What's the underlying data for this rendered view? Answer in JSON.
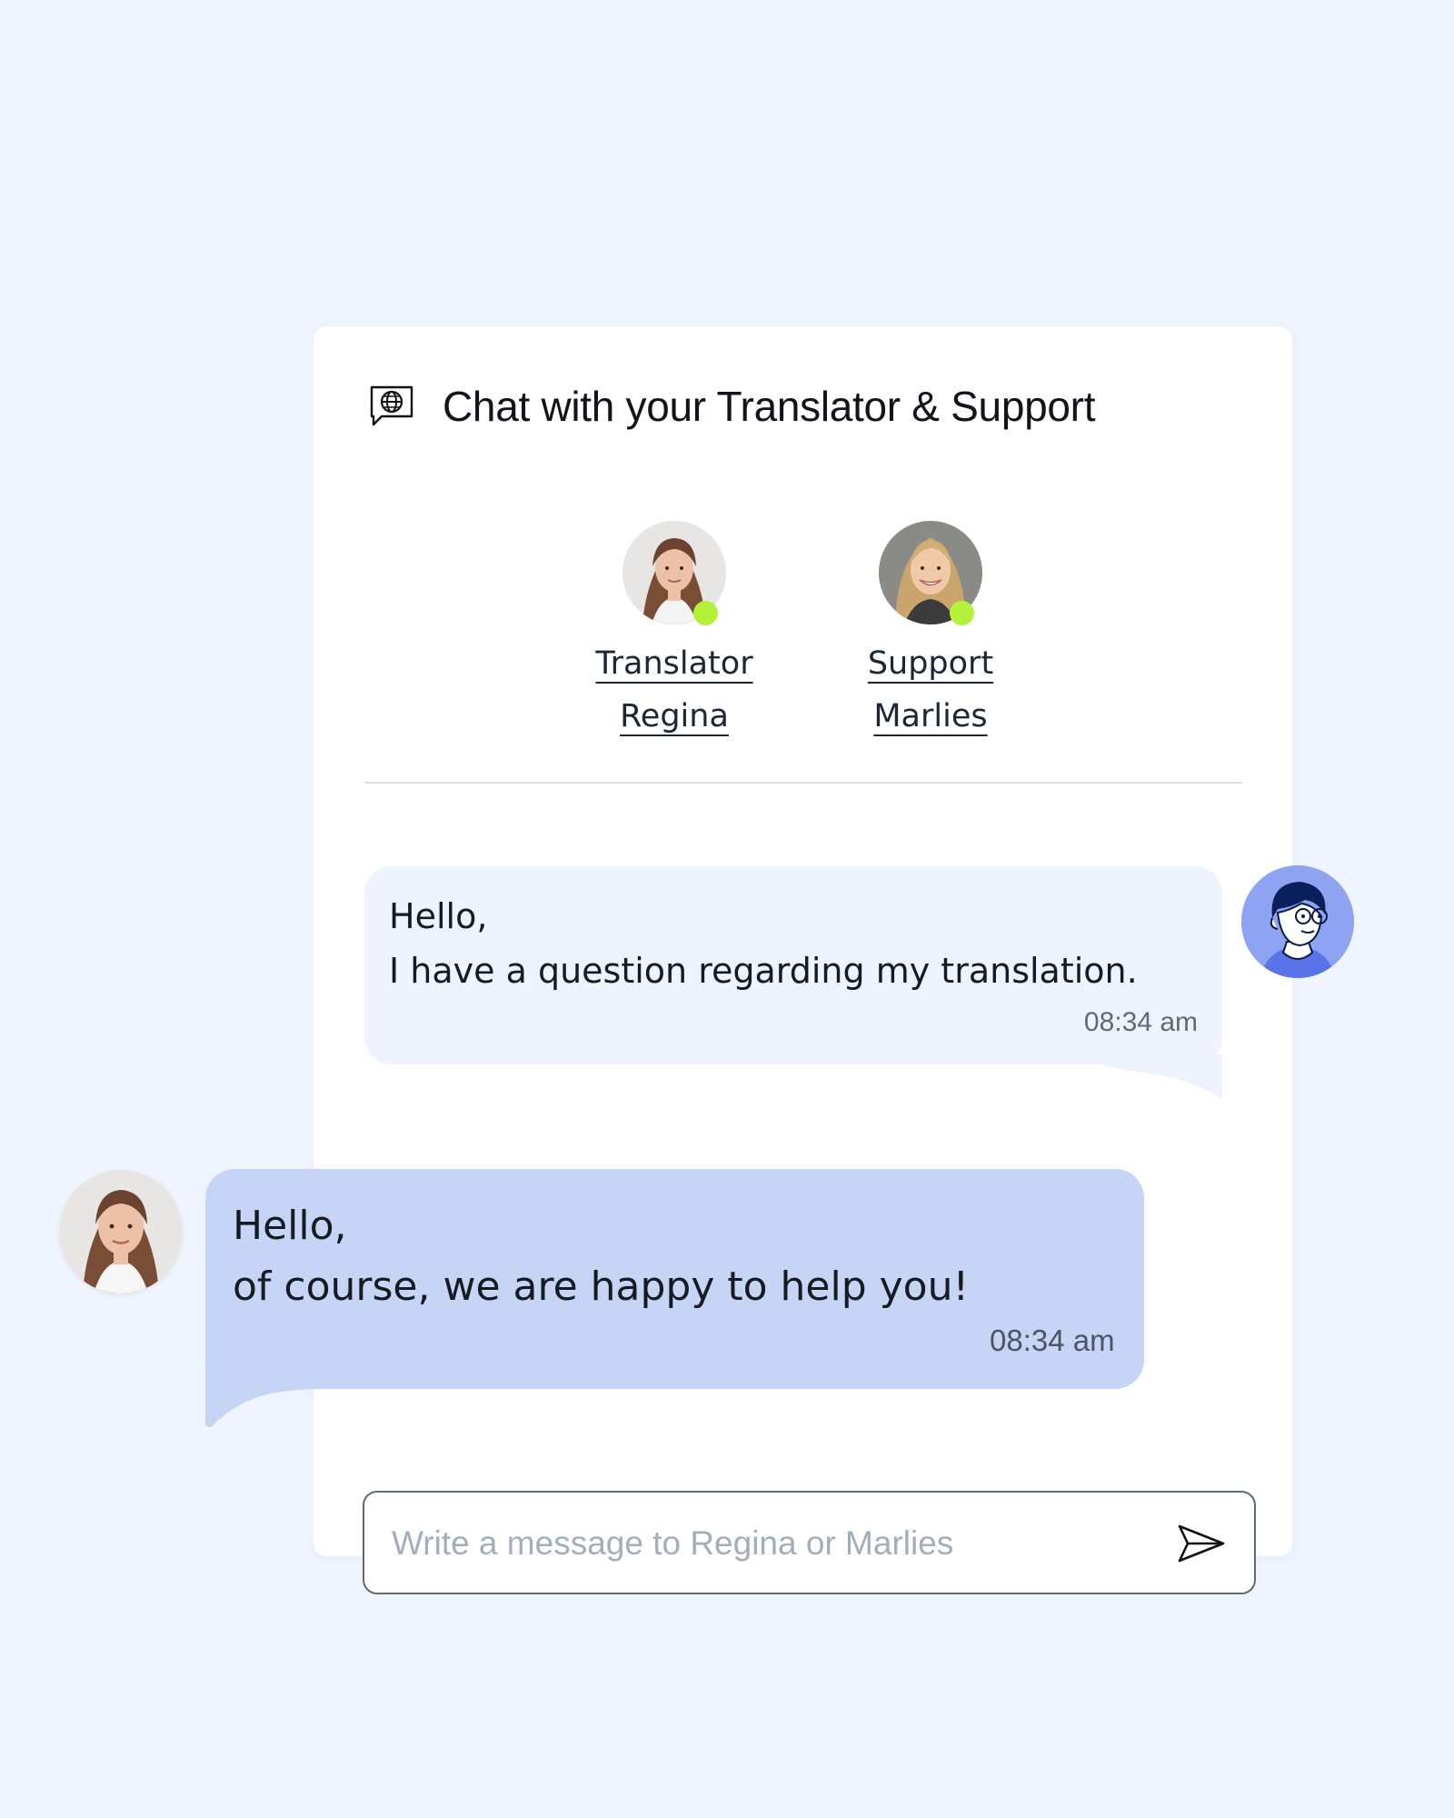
{
  "header": {
    "title": "Chat with your Translator & Support",
    "icon": "globe-chat-icon"
  },
  "agents": [
    {
      "role": "Translator",
      "name": "Regina",
      "online": true,
      "status_color": "#b4f23a"
    },
    {
      "role": "Support",
      "name": "Marlies",
      "online": true,
      "status_color": "#b4f23a"
    }
  ],
  "messages": [
    {
      "from": "user",
      "lines": [
        "Hello,",
        "I have a question regarding my translation."
      ],
      "time": "08:34 am"
    },
    {
      "from": "agent",
      "lines": [
        "Hello,",
        "of course, we are happy to help you!"
      ],
      "time": "08:34 am"
    }
  ],
  "composer": {
    "placeholder": "Write a message to Regina or Marlies",
    "value": "",
    "send_icon": "send-icon"
  },
  "colors": {
    "page_bg": "#eff4fe",
    "user_bubble": "#eef3fe",
    "agent_bubble": "#c6d5f6",
    "online": "#b4f23a",
    "user_avatar_bg": "#8ea4f2"
  }
}
